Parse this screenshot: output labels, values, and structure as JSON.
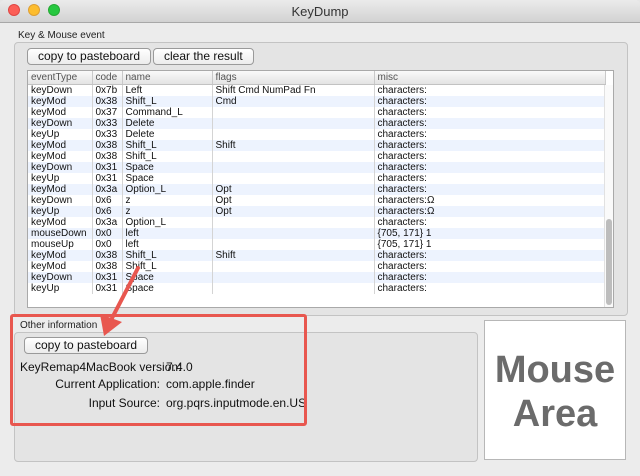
{
  "window": {
    "title": "KeyDump"
  },
  "key_mouse_event": {
    "group_label": "Key & Mouse event",
    "copy_button": "copy to pasteboard",
    "clear_button": "clear the result",
    "columns": [
      "eventType",
      "code",
      "name",
      "flags",
      "misc"
    ],
    "rows": [
      [
        "keyDown",
        "0x7b",
        "Left",
        "Shift Cmd NumPad Fn",
        "characters:"
      ],
      [
        "keyMod",
        "0x38",
        "Shift_L",
        "Cmd",
        "characters:"
      ],
      [
        "keyMod",
        "0x37",
        "Command_L",
        "",
        "characters:"
      ],
      [
        "keyDown",
        "0x33",
        "Delete",
        "",
        "characters:"
      ],
      [
        "keyUp",
        "0x33",
        "Delete",
        "",
        "characters:"
      ],
      [
        "keyMod",
        "0x38",
        "Shift_L",
        "Shift",
        "characters:"
      ],
      [
        "keyMod",
        "0x38",
        "Shift_L",
        "",
        "characters:"
      ],
      [
        "keyDown",
        "0x31",
        "Space",
        "",
        "characters:"
      ],
      [
        "keyUp",
        "0x31",
        "Space",
        "",
        "characters:"
      ],
      [
        "keyMod",
        "0x3a",
        "Option_L",
        "Opt",
        "characters:"
      ],
      [
        "keyDown",
        "0x6",
        "z",
        "Opt",
        "characters:Ω"
      ],
      [
        "keyUp",
        "0x6",
        "z",
        "Opt",
        "characters:Ω"
      ],
      [
        "keyMod",
        "0x3a",
        "Option_L",
        "",
        "characters:"
      ],
      [
        "mouseDown",
        "0x0",
        "left",
        "",
        "{705, 171} 1"
      ],
      [
        "mouseUp",
        "0x0",
        "left",
        "",
        "{705, 171} 1"
      ],
      [
        "keyMod",
        "0x38",
        "Shift_L",
        "Shift",
        "characters:"
      ],
      [
        "keyMod",
        "0x38",
        "Shift_L",
        "",
        "characters:"
      ],
      [
        "keyDown",
        "0x31",
        "Space",
        "",
        "characters:"
      ],
      [
        "keyUp",
        "0x31",
        "Space",
        "",
        "characters:"
      ]
    ]
  },
  "other_information": {
    "group_label": "Other information",
    "copy_button": "copy to pasteboard",
    "version_label": "KeyRemap4MacBook version:",
    "version_value": "7.4.0",
    "app_label": "Current Application:",
    "app_value": "com.apple.finder",
    "input_label": "Input Source:",
    "input_value": "org.pqrs.inputmode.en.US"
  },
  "mouse_area": {
    "line1": "Mouse",
    "line2": "Area"
  },
  "colors": {
    "highlight": "#e8574f",
    "row_alt": "#edf3fe"
  }
}
